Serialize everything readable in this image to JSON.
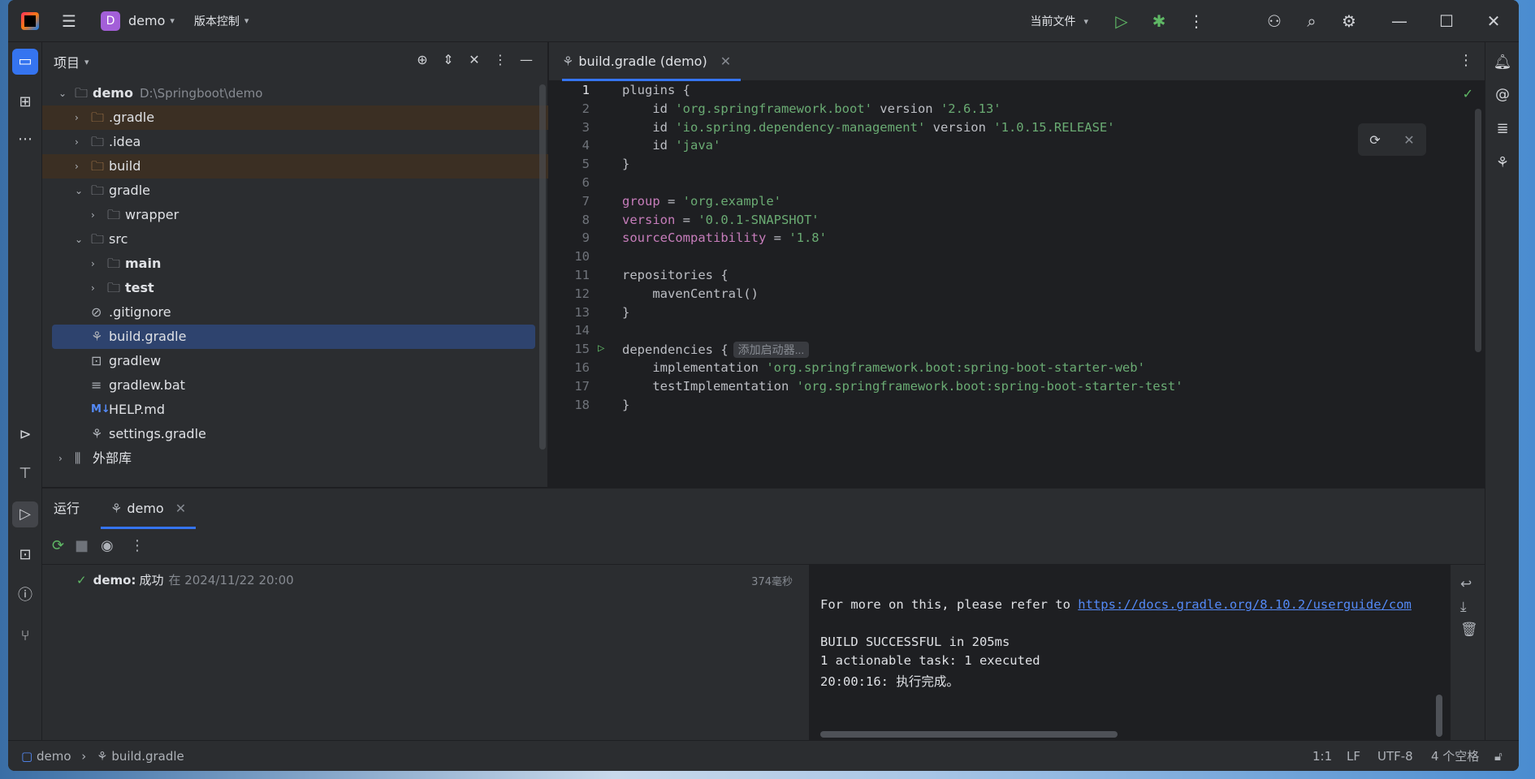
{
  "titlebar": {
    "project_initial": "D",
    "project_name": "demo",
    "vcs_label": "版本控制",
    "run_config": "当前文件"
  },
  "project_panel": {
    "title": "项目",
    "tree": [
      {
        "label": "demo",
        "path": "D:\\Springboot\\demo",
        "depth": 0,
        "expanded": true,
        "icon": "module-folder-icon",
        "bold": true
      },
      {
        "label": ".gradle",
        "depth": 1,
        "expanded": false,
        "icon": "folder-icon",
        "excluded": true
      },
      {
        "label": ".idea",
        "depth": 1,
        "expanded": false,
        "icon": "folder-icon"
      },
      {
        "label": "build",
        "depth": 1,
        "expanded": false,
        "icon": "folder-icon",
        "excluded": true
      },
      {
        "label": "gradle",
        "depth": 1,
        "expanded": true,
        "icon": "folder-icon"
      },
      {
        "label": "wrapper",
        "depth": 2,
        "expanded": false,
        "icon": "folder-icon"
      },
      {
        "label": "src",
        "depth": 1,
        "expanded": true,
        "icon": "folder-icon"
      },
      {
        "label": "main",
        "depth": 2,
        "expanded": false,
        "icon": "source-folder-icon",
        "bold": true
      },
      {
        "label": "test",
        "depth": 2,
        "expanded": false,
        "icon": "source-folder-icon",
        "bold": true
      },
      {
        "label": ".gitignore",
        "depth": 1,
        "icon": "ignore-file-icon"
      },
      {
        "label": "build.gradle",
        "depth": 1,
        "icon": "gradle-icon",
        "selected": true
      },
      {
        "label": "gradlew",
        "depth": 1,
        "icon": "shell-script-icon"
      },
      {
        "label": "gradlew.bat",
        "depth": 1,
        "icon": "text-file-icon"
      },
      {
        "label": "HELP.md",
        "depth": 1,
        "icon": "markdown-icon"
      },
      {
        "label": "settings.gradle",
        "depth": 1,
        "icon": "gradle-icon"
      },
      {
        "label": "外部库",
        "depth": 0,
        "expanded": false,
        "icon": "library-icon"
      }
    ]
  },
  "editor": {
    "tab_label": "build.gradle (demo)",
    "inlay_hint": "添加启动器...",
    "lines": [
      "plugins {",
      "    id 'org.springframework.boot' version '2.6.13'",
      "    id 'io.spring.dependency-management' version '1.0.15.RELEASE'",
      "    id 'java'",
      "}",
      "",
      "group = 'org.example'",
      "version = '0.0.1-SNAPSHOT'",
      "sourceCompatibility = '1.8'",
      "",
      "repositories {",
      "    mavenCentral()",
      "}",
      "",
      "dependencies {",
      "    implementation 'org.springframework.boot:spring-boot-starter-web'",
      "    testImplementation 'org.springframework.boot:spring-boot-starter-test'",
      "}"
    ],
    "line_numbers": [
      "1",
      "2",
      "3",
      "4",
      "5",
      "6",
      "7",
      "8",
      "9",
      "10",
      "11",
      "12",
      "13",
      "14",
      "15",
      "16",
      "17",
      "18"
    ]
  },
  "run_panel": {
    "label": "运行",
    "tab_label": "demo",
    "result_name": "demo:",
    "result_status": "成功",
    "result_time": "在 2024/11/22 20:00",
    "duration": "374毫秒",
    "console": {
      "refer_prefix": "For more on this, please refer to ",
      "refer_link": "https://docs.gradle.org/8.10.2/userguide/com",
      "line_build": "BUILD SUCCESSFUL in 205ms",
      "line_tasks": "1 actionable task: 1 executed",
      "line_done": "20:00:16: 执行完成。"
    }
  },
  "statusbar": {
    "crumb_project": "demo",
    "crumb_file": "build.gradle",
    "position": "1:1",
    "line_sep": "LF",
    "encoding": "UTF-8",
    "indent": "4 个空格"
  },
  "colors": {
    "accent": "#3574f0",
    "success": "#5fb865",
    "string": "#6aab73",
    "property": "#c77dbb",
    "link": "#548af7"
  }
}
